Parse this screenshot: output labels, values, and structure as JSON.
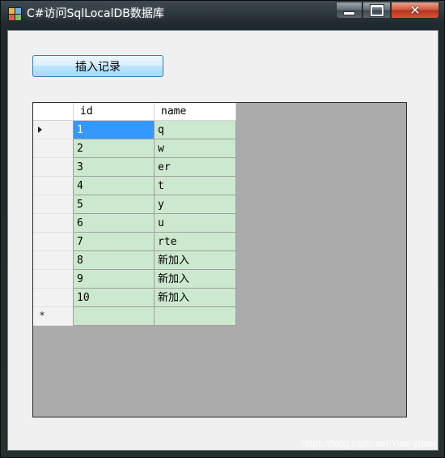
{
  "window": {
    "title": "C#访问SqlLocalDB数据库"
  },
  "toolbar": {
    "insert_label": "插入记录"
  },
  "grid": {
    "columns": [
      "id",
      "name"
    ],
    "rows": [
      {
        "id": "1",
        "name": "q"
      },
      {
        "id": "2",
        "name": "w"
      },
      {
        "id": "3",
        "name": "er"
      },
      {
        "id": "4",
        "name": "t"
      },
      {
        "id": "5",
        "name": "y"
      },
      {
        "id": "6",
        "name": "u"
      },
      {
        "id": "7",
        "name": "rte"
      },
      {
        "id": "8",
        "name": "新加入"
      },
      {
        "id": "9",
        "name": "新加入"
      },
      {
        "id": "10",
        "name": "新加入"
      }
    ],
    "new_row_marker": "*",
    "selected_row": 1,
    "cell_color": "#cce8cf",
    "selection_color": "#3399ff"
  },
  "watermark": "https://blog.csdn.net/Yuanyuxin"
}
